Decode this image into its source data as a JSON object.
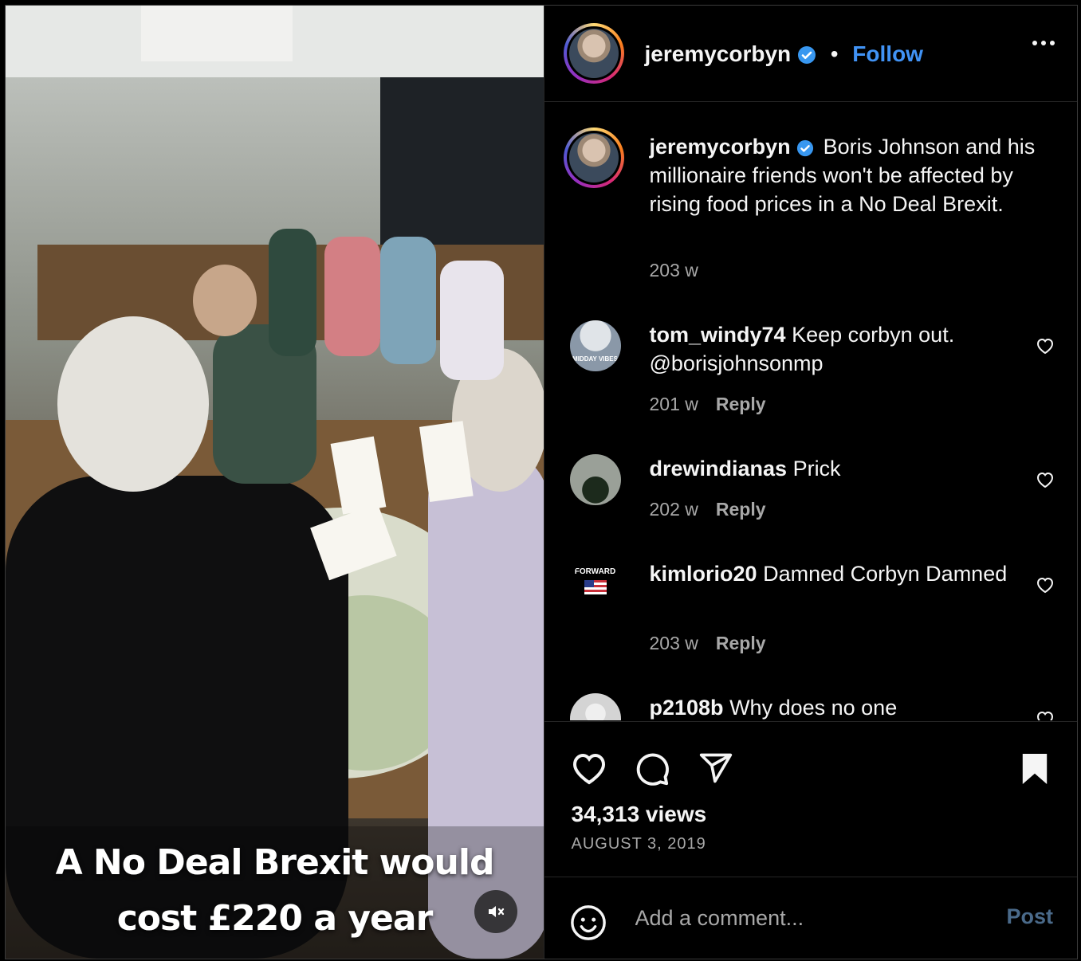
{
  "post": {
    "author": "jeremycorbyn",
    "separator": "•",
    "follow_label": "Follow",
    "caption_text": "Boris Johnson and his millionaire friends won't be affected by rising food prices in a No Deal Brexit.",
    "caption_time": "203 w",
    "video_caption_line1": "A No Deal Brexit would",
    "video_caption_line2": "cost £220 a year",
    "views": "34,313 views",
    "date": "AUGUST 3, 2019"
  },
  "comments": [
    {
      "user": "tom_windy74",
      "text": "Keep corbyn out. @borisjohnsonmp",
      "time": "201 w",
      "reply": "Reply",
      "avatar_label": "MIDDAY VIBES"
    },
    {
      "user": "drewindianas",
      "text": "Prick",
      "time": "202 w",
      "reply": "Reply"
    },
    {
      "user": "kimlorio20",
      "text": "Damned Corbyn Damned",
      "time": "203 w",
      "reply": "Reply",
      "avatar_label": "FORWARD"
    },
    {
      "user": "p2108b",
      "text": "Why does no one"
    }
  ],
  "add_comment": {
    "placeholder": "Add a comment...",
    "post_label": "Post"
  },
  "colors": {
    "link_blue": "#4193f5",
    "verified_blue": "#3897f0",
    "muted": "#a8a8a8",
    "background": "#000000"
  },
  "icons": [
    "more-icon",
    "verified-icon",
    "like-icon",
    "comment-icon",
    "share-icon",
    "save-icon",
    "emoji-icon",
    "mute-icon"
  ]
}
